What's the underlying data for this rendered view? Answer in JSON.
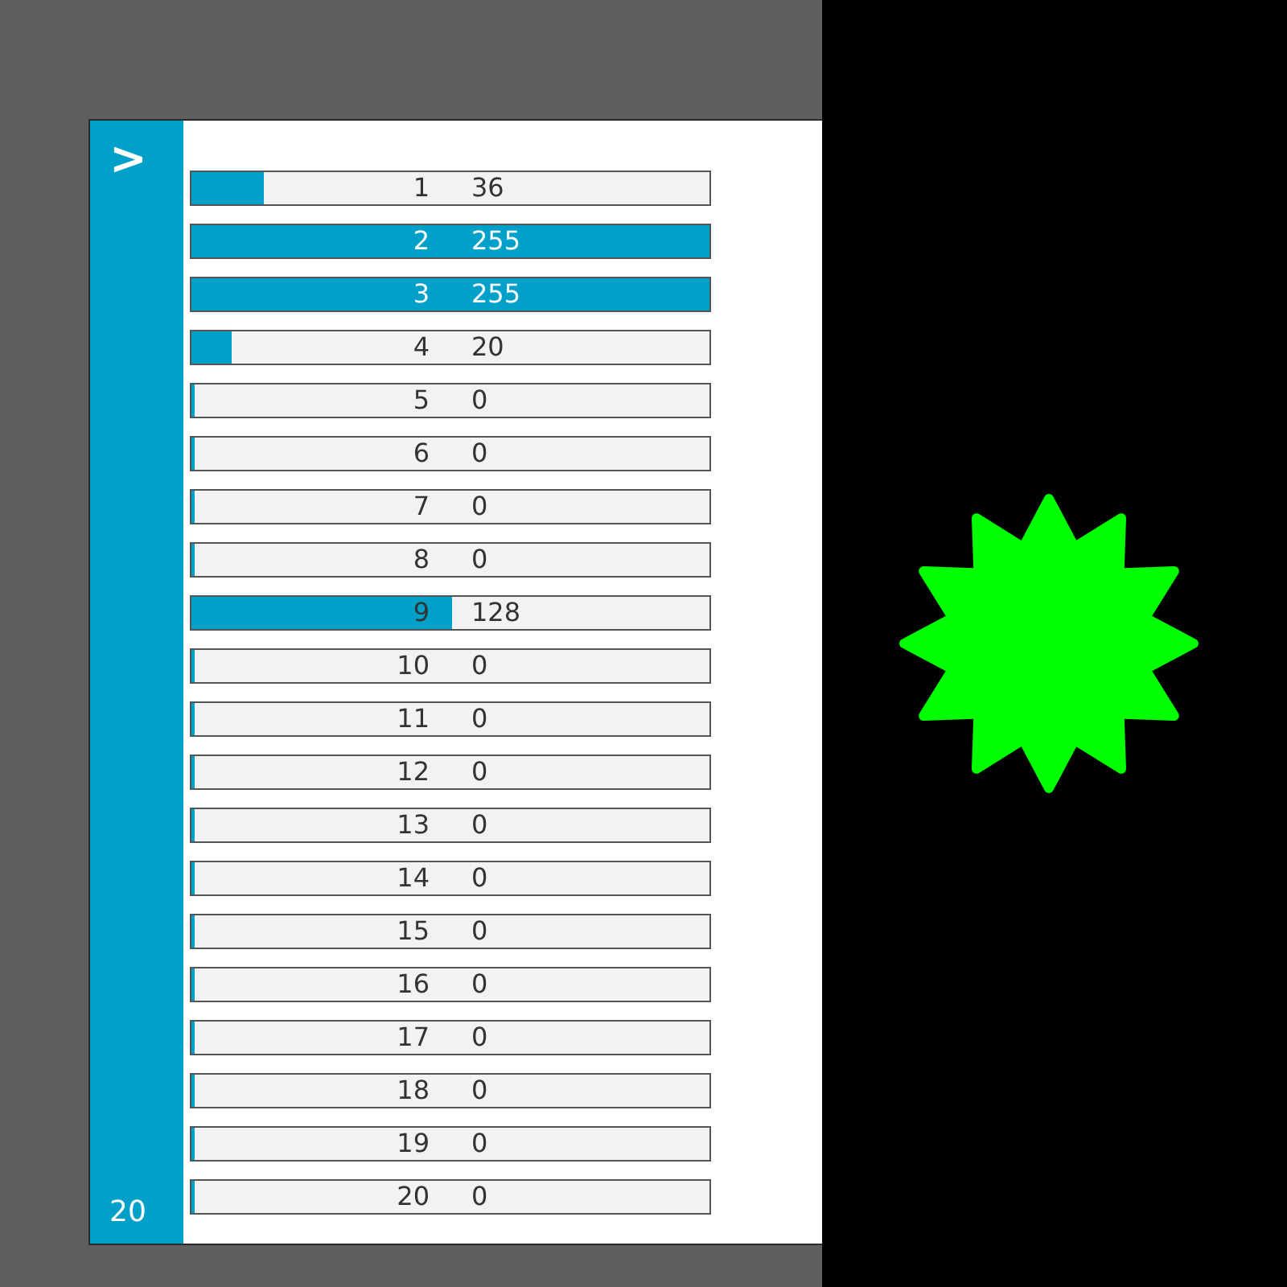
{
  "sidebar": {
    "toggle": ">",
    "count": "20"
  },
  "channels": [
    {
      "number": "1",
      "value": "36",
      "level": 0.141
    },
    {
      "number": "2",
      "value": "255",
      "level": 1
    },
    {
      "number": "3",
      "value": "255",
      "level": 1
    },
    {
      "number": "4",
      "value": "20",
      "level": 0.078
    },
    {
      "number": "5",
      "value": "0",
      "level": 0
    },
    {
      "number": "6",
      "value": "0",
      "level": 0
    },
    {
      "number": "7",
      "value": "0",
      "level": 0
    },
    {
      "number": "8",
      "value": "0",
      "level": 0
    },
    {
      "number": "9",
      "value": "128",
      "level": 0.502
    },
    {
      "number": "10",
      "value": "0",
      "level": 0
    },
    {
      "number": "11",
      "value": "0",
      "level": 0
    },
    {
      "number": "12",
      "value": "0",
      "level": 0
    },
    {
      "number": "13",
      "value": "0",
      "level": 0
    },
    {
      "number": "14",
      "value": "0",
      "level": 0
    },
    {
      "number": "15",
      "value": "0",
      "level": 0
    },
    {
      "number": "16",
      "value": "0",
      "level": 0
    },
    {
      "number": "17",
      "value": "0",
      "level": 0
    },
    {
      "number": "18",
      "value": "0",
      "level": 0
    },
    {
      "number": "19",
      "value": "0",
      "level": 0
    },
    {
      "number": "20",
      "value": "0",
      "level": 0
    }
  ]
}
